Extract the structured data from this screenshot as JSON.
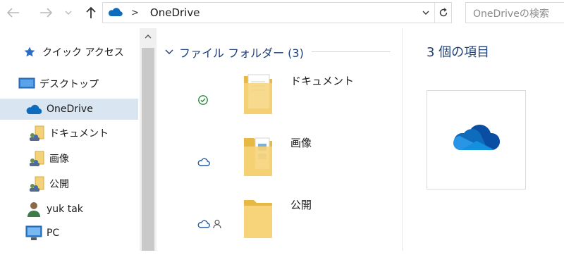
{
  "address_bar": {
    "back_icon": "back-arrow-icon",
    "forward_icon": "forward-arrow-icon",
    "up_icon": "up-arrow-icon",
    "separator": ">",
    "path": "OneDrive",
    "search_placeholder": "OneDriveの検索"
  },
  "sidebar": {
    "items": [
      {
        "label": "クイック アクセス",
        "icon": "star-icon"
      },
      {
        "label": "デスクトップ",
        "icon": "desktop-icon"
      },
      {
        "label": "OneDrive",
        "icon": "onedrive-cloud-icon",
        "selected": true
      },
      {
        "label": "ドキュメント",
        "icon": "shared-folder-icon"
      },
      {
        "label": "画像",
        "icon": "shared-folder-icon"
      },
      {
        "label": "公開",
        "icon": "shared-folder-icon"
      },
      {
        "label": "yuk tak",
        "icon": "user-icon"
      },
      {
        "label": "PC",
        "icon": "pc-icon"
      }
    ]
  },
  "main": {
    "group_header": "ファイル フォルダー (3)",
    "files": [
      {
        "name": "ドキュメント",
        "status_icon": "synced-check-icon"
      },
      {
        "name": "画像",
        "status_icon": "cloud-only-icon"
      },
      {
        "name": "公開",
        "status_icon": "cloud-shared-icon"
      }
    ]
  },
  "preview": {
    "count": "3 個の項目",
    "thumb_icon": "onedrive-cloud-large-icon"
  },
  "colors": {
    "accent": "#1e3f78",
    "selected_bg": "#d9e6f2",
    "onedrive_blue": "#0f6cbd"
  }
}
